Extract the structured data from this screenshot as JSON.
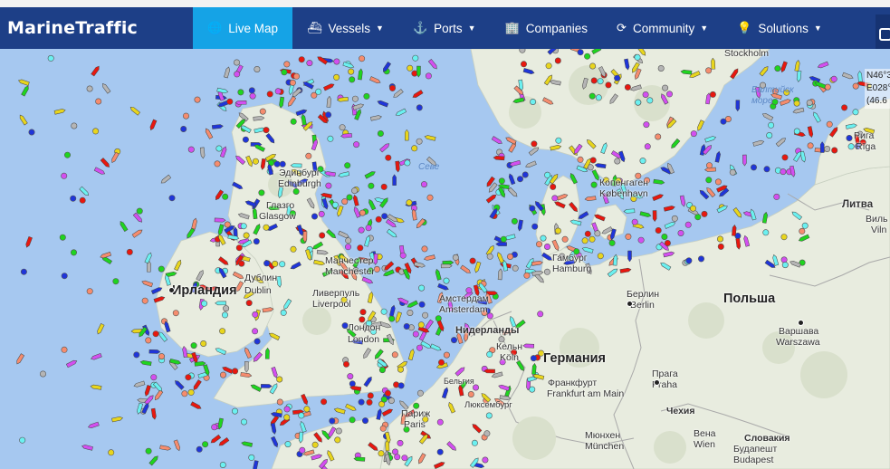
{
  "app": {
    "logo": "MarineTraffic"
  },
  "nav": [
    {
      "label": "Live Map",
      "icon": "globe-icon",
      "glyph": "🌐",
      "active": true,
      "caret": false
    },
    {
      "label": "Vessels",
      "icon": "ship-icon",
      "glyph": "⛴",
      "caret": true
    },
    {
      "label": "Ports",
      "icon": "anchor-icon",
      "glyph": "⚓",
      "caret": true
    },
    {
      "label": "Companies",
      "icon": "building-icon",
      "glyph": "🏢",
      "caret": false
    },
    {
      "label": "Community",
      "icon": "refresh-icon",
      "glyph": "⟳",
      "caret": true
    },
    {
      "label": "Solutions",
      "icon": "lightbulb-icon",
      "glyph": "💡",
      "caret": true
    }
  ],
  "caret_glyph": "▼",
  "colors": {
    "navbar": "#1d3f87",
    "active_tab": "#15a3e6",
    "sea": "#a6c8f0",
    "coastal": "#5ea0f0",
    "land": "#e8ecdf"
  },
  "coords": {
    "lat": "N46°3",
    "lon": "E028°",
    "extra": "(46.6"
  },
  "map_labels": {
    "countries": [
      {
        "name": "ireland",
        "text": "Ирландия"
      },
      {
        "name": "germany",
        "text": "Германия"
      },
      {
        "name": "poland",
        "text": "Польша"
      },
      {
        "name": "lithuania",
        "text": "Литва"
      },
      {
        "name": "czech",
        "text": "Чехия"
      },
      {
        "name": "slovakia",
        "text": "Словакия"
      },
      {
        "name": "netherlands",
        "text": "Нидерланды"
      },
      {
        "name": "belgium",
        "text": "Бельгия"
      }
    ],
    "cities": [
      {
        "name": "edinburgh",
        "ru": "Эдинбург",
        "en": "Edinburgh"
      },
      {
        "name": "glasgow",
        "ru": "Глазго",
        "en": "Glasgow"
      },
      {
        "name": "dublin",
        "ru": "Дублин",
        "en": "Dublin"
      },
      {
        "name": "manchester",
        "ru": "Манчестер",
        "en": "Manchester"
      },
      {
        "name": "liverpool",
        "ru": "Ливерпуль",
        "en": "Liverpool"
      },
      {
        "name": "london",
        "ru": "Лондон",
        "en": "London"
      },
      {
        "name": "paris",
        "ru": "Париж",
        "en": "Paris"
      },
      {
        "name": "amsterdam",
        "ru": "Амстердам",
        "en": "Amsterdam"
      },
      {
        "name": "cologne",
        "ru": "Кельн",
        "en": "Köln"
      },
      {
        "name": "luxembourg",
        "ru": "Люксембург",
        "en": ""
      },
      {
        "name": "frankfurt",
        "ru": "Франкфурт",
        "en": "Frankfurt am Main"
      },
      {
        "name": "munich",
        "ru": "Мюнхен",
        "en": "München"
      },
      {
        "name": "hamburg",
        "ru": "Гамбург",
        "en": "Hamburg"
      },
      {
        "name": "berlin",
        "ru": "Берлин",
        "en": "Berlin"
      },
      {
        "name": "prague",
        "ru": "Прага",
        "en": "Praha"
      },
      {
        "name": "vienna",
        "ru": "Вена",
        "en": "Wien"
      },
      {
        "name": "budapest",
        "ru": "Будапешт",
        "en": "Budapest"
      },
      {
        "name": "warsaw",
        "ru": "Варшава",
        "en": "Warszawa"
      },
      {
        "name": "copenhagen",
        "ru": "Копенгаген",
        "en": "København"
      },
      {
        "name": "riga",
        "ru": "Рига",
        "en": "Rīga"
      },
      {
        "name": "vilnius",
        "ru": "Виль",
        "en": "Viln"
      },
      {
        "name": "stockholm",
        "ru": "",
        "en": "Stockholm"
      }
    ],
    "seas": [
      {
        "name": "north-sea",
        "text": "Севе"
      },
      {
        "name": "baltic-sea",
        "text": "Балтийск\nморе"
      }
    ]
  },
  "vessel_colors": [
    "#1fd41f",
    "#e8170f",
    "#1f35d9",
    "#f58c6e",
    "#6bf0f0",
    "#e8d51d",
    "#d34ff0",
    "#b5b5b5"
  ]
}
